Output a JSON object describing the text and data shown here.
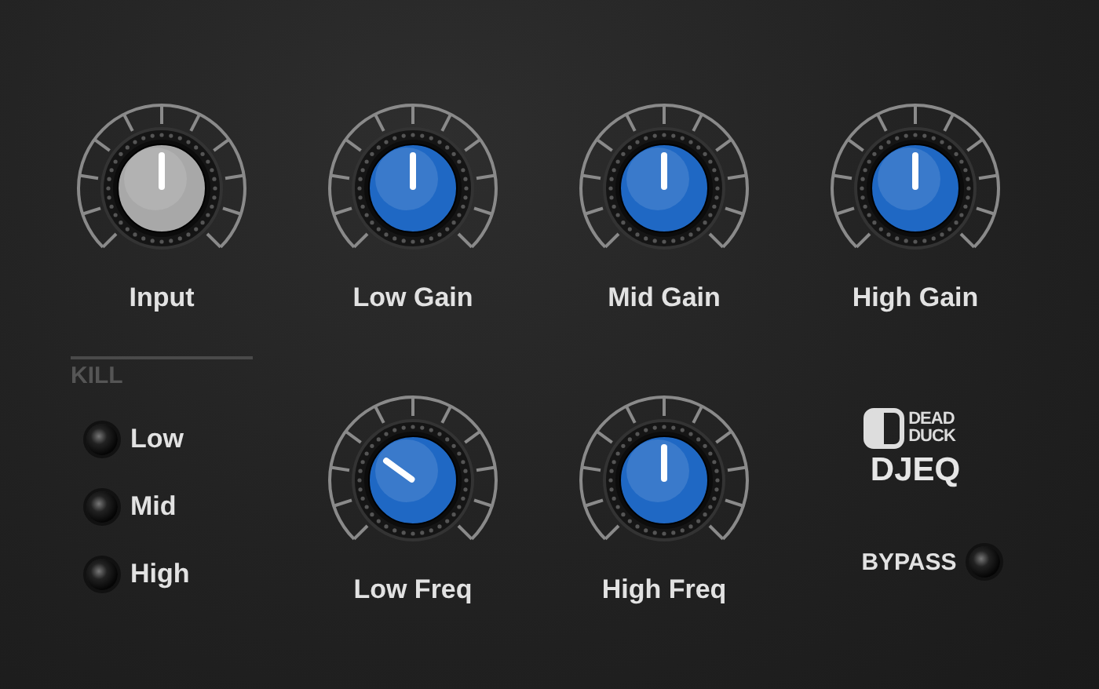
{
  "knobs_top": [
    {
      "label": "Input",
      "level": 0.5,
      "color": "#a8a8a8"
    },
    {
      "label": "Low Gain",
      "level": 0.5,
      "color": "#1f68c4"
    },
    {
      "label": "Mid Gain",
      "level": 0.5,
      "color": "#1f68c4"
    },
    {
      "label": "High Gain",
      "level": 0.5,
      "color": "#1f68c4"
    }
  ],
  "kill": {
    "title": "KILL",
    "switches": [
      {
        "label": "Low",
        "on": false
      },
      {
        "label": "Mid",
        "on": false
      },
      {
        "label": "High",
        "on": false
      }
    ]
  },
  "knobs_bottom": [
    {
      "label": "Low Freq",
      "level": 0.3,
      "color": "#1f68c4"
    },
    {
      "label": "High Freq",
      "level": 0.5,
      "color": "#1f68c4"
    }
  ],
  "brand": {
    "maker_lines": [
      "DEAD",
      "DUCK"
    ],
    "product": "DJEQ"
  },
  "bypass": {
    "label": "BYPASS",
    "on": false
  }
}
